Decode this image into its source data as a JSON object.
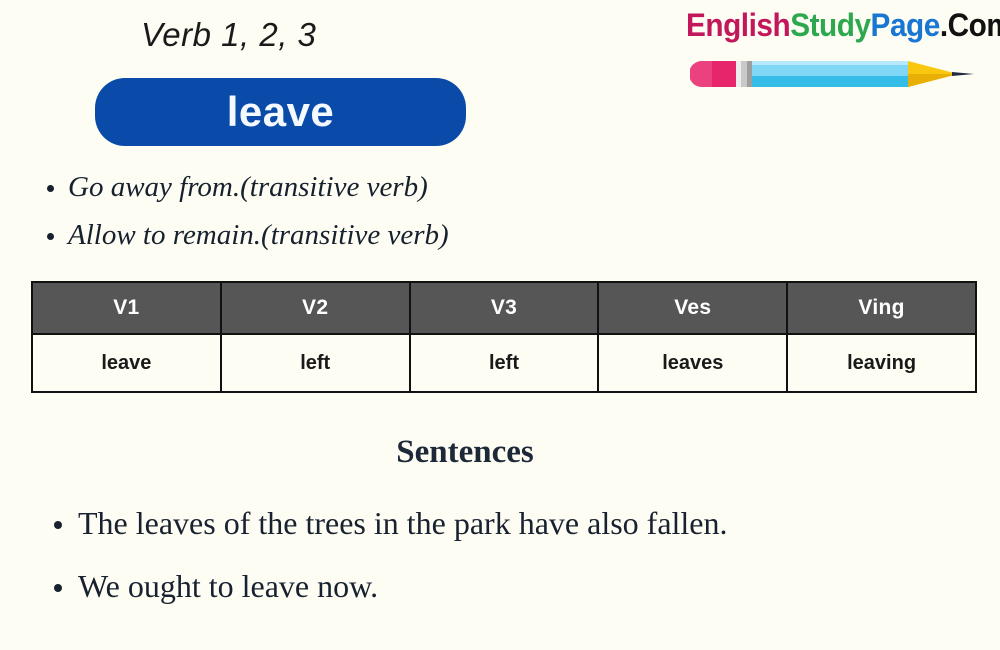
{
  "page": {
    "background_color": "#fdfdf3"
  },
  "logo": {
    "part1": "English",
    "part2": "Study",
    "part3": "Page",
    "part4": ".Com",
    "colors": {
      "part1": "#c2185b",
      "part2": "#2ea84f",
      "part3": "#1976d2",
      "part4": "#111111"
    },
    "icon": "pencil-icon",
    "pencil_colors": {
      "eraser": "#e6256a",
      "ferrule": "#c9c9c9",
      "body": "#7fd6f5",
      "body_stripe": "#34bde8",
      "cone": "#f9c610",
      "tip": "#232a43"
    }
  },
  "header": {
    "kicker": "Verb 1, 2, 3",
    "verb": "leave",
    "pill_color": "#0a4baa",
    "pill_text_color": "#f4f8ff"
  },
  "definitions": [
    "Go away from.(transitive verb)",
    "Allow to remain.(transitive verb)"
  ],
  "table": {
    "headers": [
      "V1",
      "V2",
      "V3",
      "Ves",
      "Ving"
    ],
    "rows": [
      [
        "leave",
        "left",
        "left",
        "leaves",
        "leaving"
      ]
    ],
    "header_bg": "#565656",
    "header_color": "#ffffff",
    "border_color": "#111111"
  },
  "sentences_section": {
    "title": "Sentences",
    "items": [
      "The leaves of the trees in the park have also fallen.",
      "We ought to leave now."
    ]
  }
}
